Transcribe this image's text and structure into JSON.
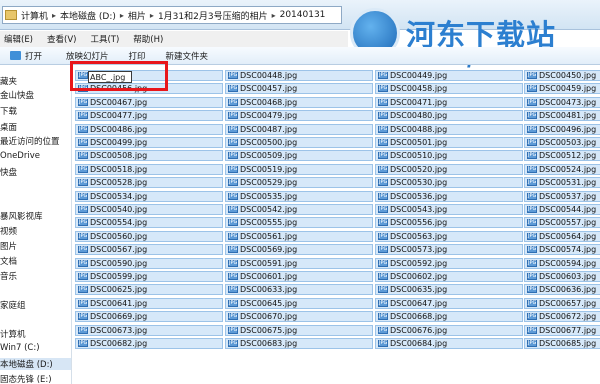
{
  "address_bar": {
    "crumbs": [
      "计算机",
      "本地磁盘 (D:)",
      "相片",
      "1月31和2月3号压缩的相片",
      "20140131"
    ]
  },
  "logo": {
    "name": "河东下载站",
    "url": "www.pc0359.cn"
  },
  "menu": [
    "编辑(E)",
    "查看(V)",
    "工具(T)",
    "帮助(H)"
  ],
  "toolbar": {
    "open_label": "打开",
    "slideshow_label": "放映幻灯片",
    "print_label": "打印",
    "new_folder_label": "新建文件夹"
  },
  "sidebar": {
    "items": [
      "藏夹",
      "金山快盘",
      "下载",
      "桌面",
      "最近访问的位置",
      "OneDrive",
      "快盘",
      "",
      "暴风影视库",
      "视频",
      "图片",
      "文档",
      "音乐",
      "",
      "家庭组",
      "",
      "计算机",
      "Win7 (C:)",
      "本地磁盘 (D:)",
      "固态先锋 (E:)"
    ],
    "selected_index": 18
  },
  "rename": {
    "value": "ABC_.jpg"
  },
  "icon_label": "JPG",
  "files": {
    "columns": [
      [
        "",
        "DSC00456.jpg",
        "DSC00467.jpg",
        "DSC00477.jpg",
        "DSC00486.jpg",
        "DSC00499.jpg",
        "DSC00508.jpg",
        "DSC00518.jpg",
        "DSC00528.jpg",
        "DSC00534.jpg",
        "DSC00540.jpg",
        "DSC00554.jpg",
        "DSC00560.jpg",
        "DSC00567.jpg",
        "DSC00590.jpg",
        "DSC00599.jpg",
        "DSC00625.jpg",
        "DSC00641.jpg",
        "DSC00669.jpg",
        "DSC00673.jpg",
        "DSC00682.jpg"
      ],
      [
        "DSC00448.jpg",
        "DSC00457.jpg",
        "DSC00468.jpg",
        "DSC00479.jpg",
        "DSC00487.jpg",
        "DSC00500.jpg",
        "DSC00509.jpg",
        "DSC00519.jpg",
        "DSC00529.jpg",
        "DSC00535.jpg",
        "DSC00542.jpg",
        "DSC00555.jpg",
        "DSC00561.jpg",
        "DSC00569.jpg",
        "DSC00591.jpg",
        "DSC00601.jpg",
        "DSC00633.jpg",
        "DSC00645.jpg",
        "DSC00670.jpg",
        "DSC00675.jpg",
        "DSC00683.jpg"
      ],
      [
        "DSC00449.jpg",
        "DSC00458.jpg",
        "DSC00471.jpg",
        "DSC00480.jpg",
        "DSC00488.jpg",
        "DSC00501.jpg",
        "DSC00510.jpg",
        "DSC00520.jpg",
        "DSC00530.jpg",
        "DSC00536.jpg",
        "DSC00543.jpg",
        "DSC00556.jpg",
        "DSC00563.jpg",
        "DSC00573.jpg",
        "DSC00592.jpg",
        "DSC00602.jpg",
        "DSC00635.jpg",
        "DSC00647.jpg",
        "DSC00668.jpg",
        "DSC00676.jpg",
        "DSC00684.jpg"
      ],
      [
        "DSC00450.jpg",
        "DSC00459.jpg",
        "DSC00473.jpg",
        "DSC00481.jpg",
        "DSC00496.jpg",
        "DSC00503.jpg",
        "DSC00512.jpg",
        "DSC00524.jpg",
        "DSC00531.jpg",
        "DSC00537.jpg",
        "DSC00544.jpg",
        "DSC00557.jpg",
        "DSC00564.jpg",
        "DSC00574.jpg",
        "DSC00594.jpg",
        "DSC00603.jpg",
        "DSC00636.jpg",
        "DSC00657.jpg",
        "DSC00672.jpg",
        "DSC00677.jpg",
        "DSC00685.jpg"
      ]
    ]
  }
}
